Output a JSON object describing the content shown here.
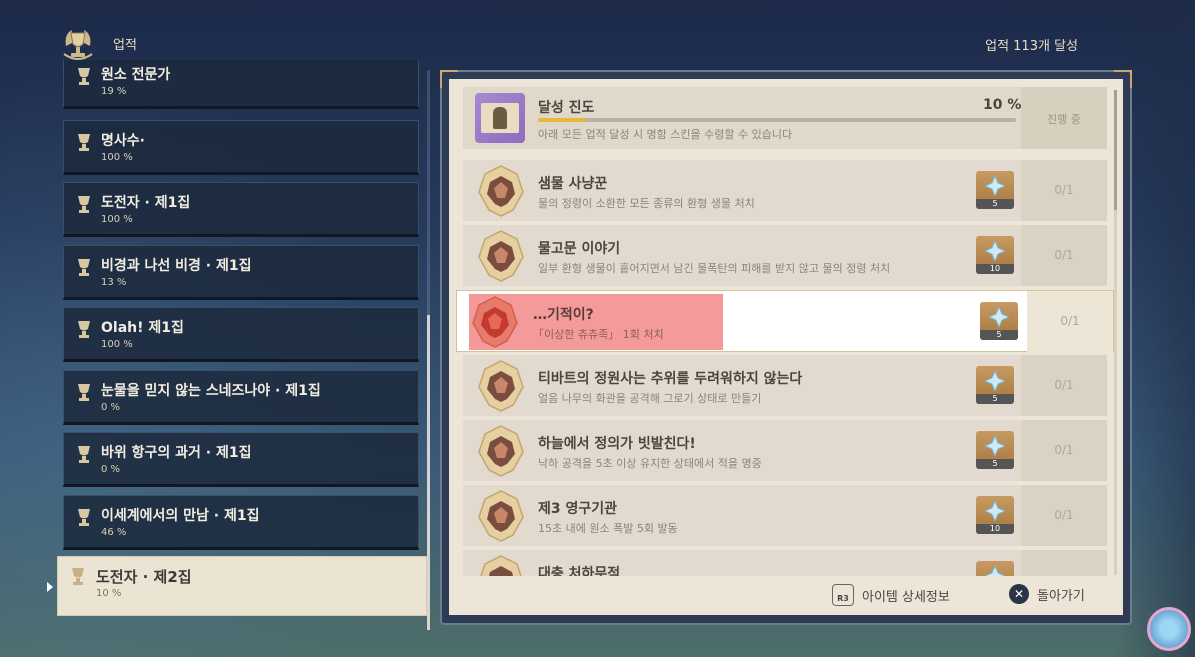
{
  "header": {
    "title": "업적",
    "count": "업적 113개 달성"
  },
  "categories": [
    {
      "name": "원소 전문가",
      "pct": "19 %"
    },
    {
      "name": "명사수·",
      "pct": "100 %"
    },
    {
      "name": "도전자 · 제1집",
      "pct": "100 %"
    },
    {
      "name": "비경과 나선 비경 · 제1집",
      "pct": "13 %"
    },
    {
      "name": "Olah! 제1집",
      "pct": "100 %"
    },
    {
      "name": "눈물을 믿지 않는 스네즈나야 · 제1집",
      "pct": "0 %"
    },
    {
      "name": "바위 항구의 과거 · 제1집",
      "pct": "0 %"
    },
    {
      "name": "이세계에서의 만남 · 제1집",
      "pct": "46 %"
    }
  ],
  "selected_category": {
    "name": "도전자 · 제2집",
    "pct": "10 %"
  },
  "progress": {
    "title": "달성 진도",
    "pct": "10 %",
    "fill_fraction": 0.1,
    "desc": "아래 모든 업적 달성 시 명함 스킨을 수령할 수 있습니다",
    "status": "진행 중"
  },
  "achievements": [
    {
      "name": "샘물 사냥꾼",
      "desc": "물의 정령이 소환한 모든 종류의 환형 생물 처치",
      "reward": "5",
      "status": "0/1"
    },
    {
      "name": "물고문 이야기",
      "desc": "일부 환형 생물이 흩어지면서 남긴 물폭탄의 피해를 받지 않고 물의 정령 처치",
      "reward": "10",
      "status": "0/1"
    },
    {
      "name": "…기적이?",
      "desc": "「이상한 츄츄족」 1회 처치",
      "reward": "5",
      "status": "0/1"
    },
    {
      "name": "티바트의 정원사는 추위를 두려워하지 않는다",
      "desc": "얼음 나무의 화관을 공격해 그로기 상태로 만들기",
      "reward": "5",
      "status": "0/1"
    },
    {
      "name": "하늘에서 정의가 빗발친다!",
      "desc": "낙하 공격을 5초 이상 유지한 상태에서 적을 명중",
      "reward": "5",
      "status": "0/1"
    },
    {
      "name": "제3 영구기관",
      "desc": "15초 내에 원소 폭발 5회 발동",
      "reward": "10",
      "status": "0/1"
    },
    {
      "name": "대충 처하무적",
      "desc": "",
      "reward": "",
      "status": ""
    }
  ],
  "footer": {
    "detail_label": "아이템 상세정보",
    "detail_key": "R3",
    "back_label": "돌아가기",
    "back_key": "✕"
  },
  "colors": {
    "accent_gold": "#e6b73c",
    "highlight_red": "#f59a9a",
    "paper": "#ece5d8"
  }
}
